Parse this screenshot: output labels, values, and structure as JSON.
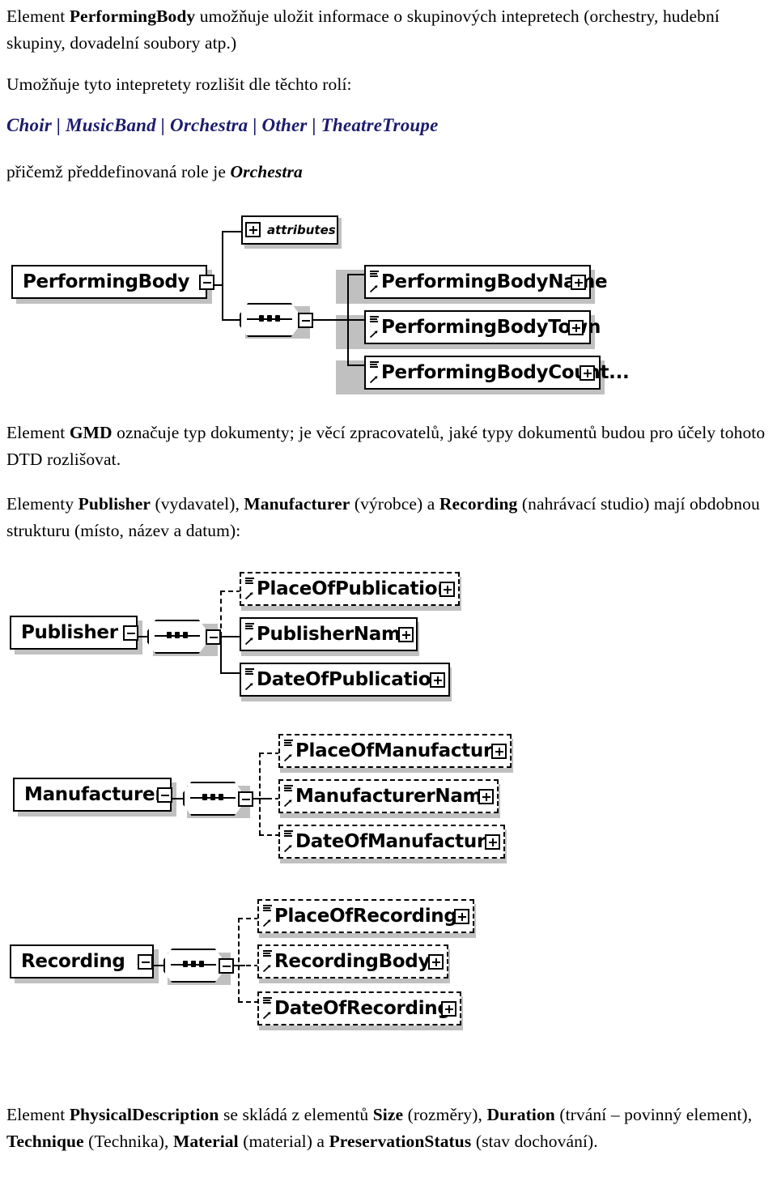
{
  "document": {
    "language": "cs",
    "paragraphs": {
      "p1": {
        "prefix": "Element ",
        "bold": "PerformingBody",
        "suffix": " umožňuje uložit informace o skupinových intepretech (orchestry, hudební skupiny, dovadelní soubory atp.)"
      },
      "p2": {
        "text": "Umožňuje tyto intepretety rozlišit dle těchto rolí:"
      },
      "roles": {
        "items": [
          "Choir",
          "MusicBand",
          "Orchestra",
          "Other",
          "TheatreTroupe"
        ],
        "separator": "|",
        "color": "#1b1b6e",
        "full_text": "Choir | MusicBand | Orchestra | Other | TheatreTroupe"
      },
      "p3": {
        "prefix": "přičemž předdefinovaná role je ",
        "italic": "Orchestra"
      },
      "p4": {
        "prefix": "Element ",
        "bold": "GMD",
        "suffix": " označuje typ dokumenty; je věcí zpracovatelů, jaké typy dokumentů budou pro účely tohoto DTD rozlišovat."
      },
      "p5": {
        "seg1": "Elementy ",
        "b1": "Publisher",
        "seg2": " (vydavatel), ",
        "b2": "Manufacturer",
        "seg3": " (výrobce) a ",
        "b3": "Recording",
        "seg4": " (nahrávací studio) mají obdobnou strukturu (místo, název a datum):"
      },
      "p6": {
        "seg1": "Element ",
        "b1": "PhysicalDescription",
        "seg2": " se skládá z elementů ",
        "b2": "Size",
        "seg3": " (rozměry), ",
        "b3": "Duration",
        "seg4": " (trvání – povinný element), ",
        "b4": "Technique",
        "seg5": " (Technika), ",
        "b5": "Material",
        "seg6": " (material) a ",
        "b6": "PreservationStatus",
        "seg7": " (stav dochování)."
      }
    }
  },
  "diagrams": [
    {
      "id": "performingbody-diagram",
      "root": {
        "label": "PerformingBody",
        "toggle": "minus",
        "style": "solid"
      },
      "attributes_node": {
        "label": "attributes",
        "toggle": "plus"
      },
      "compositor": {
        "type": "sequence",
        "toggle": "minus"
      },
      "children": [
        {
          "label": "PerformingBodyName",
          "toggle": "plus",
          "style": "solid",
          "connector": "solid"
        },
        {
          "label": "PerformingBodyTown",
          "toggle": "plus",
          "style": "solid",
          "connector": "solid"
        },
        {
          "label": "PerformingBodyCount...",
          "toggle": "plus",
          "style": "solid",
          "connector": "solid"
        }
      ]
    },
    {
      "id": "publisher-diagram",
      "root": {
        "label": "Publisher",
        "toggle": "minus",
        "style": "solid"
      },
      "compositor": {
        "type": "sequence",
        "toggle": "minus"
      },
      "children": [
        {
          "label": "PlaceOfPublication",
          "toggle": "plus",
          "style": "dashed",
          "connector": "dashed"
        },
        {
          "label": "PublisherName",
          "toggle": "plus",
          "style": "solid",
          "connector": "solid"
        },
        {
          "label": "DateOfPublication",
          "toggle": "plus",
          "style": "solid",
          "connector": "solid"
        }
      ]
    },
    {
      "id": "manufacturer-diagram",
      "root": {
        "label": "Manufacturer",
        "toggle": "minus",
        "style": "solid"
      },
      "compositor": {
        "type": "sequence",
        "toggle": "minus"
      },
      "children": [
        {
          "label": "PlaceOfManufacture",
          "toggle": "plus",
          "style": "dashed",
          "connector": "dashed"
        },
        {
          "label": "ManufacturerName",
          "toggle": "plus",
          "style": "dashed",
          "connector": "dashed"
        },
        {
          "label": "DateOfManufacture",
          "toggle": "plus",
          "style": "dashed",
          "connector": "dashed"
        }
      ]
    },
    {
      "id": "recording-diagram",
      "root": {
        "label": "Recording",
        "toggle": "minus",
        "style": "solid"
      },
      "compositor": {
        "type": "sequence",
        "toggle": "minus"
      },
      "children": [
        {
          "label": "PlaceOfRecording",
          "toggle": "plus",
          "style": "dashed",
          "connector": "dashed"
        },
        {
          "label": "RecordingBody",
          "toggle": "plus",
          "style": "dashed",
          "connector": "dashed"
        },
        {
          "label": "DateOfRecording",
          "toggle": "plus",
          "style": "dashed",
          "connector": "dashed"
        }
      ]
    }
  ]
}
